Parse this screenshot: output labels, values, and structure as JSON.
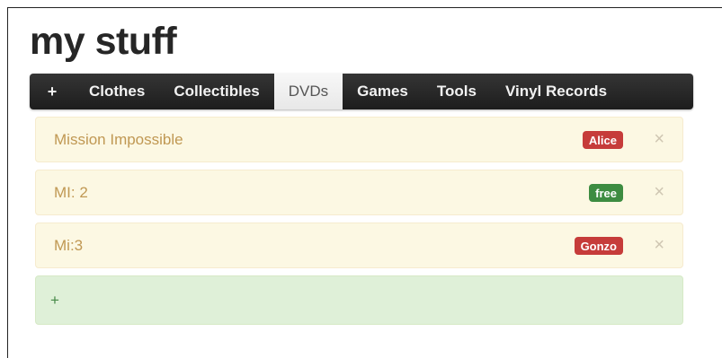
{
  "page": {
    "title": "my stuff"
  },
  "nav": {
    "add_label": "+",
    "tabs": [
      {
        "label": "Clothes",
        "active": false
      },
      {
        "label": "Collectibles",
        "active": false
      },
      {
        "label": "DVDs",
        "active": true
      },
      {
        "label": "Games",
        "active": false
      },
      {
        "label": "Tools",
        "active": false
      },
      {
        "label": "Vinyl Records",
        "active": false
      }
    ]
  },
  "items": [
    {
      "title": "Mission Impossible",
      "badge": "Alice",
      "badge_color": "#c63c3a",
      "remove_icon": "×"
    },
    {
      "title": "MI: 2",
      "badge": "free",
      "badge_color": "#3d8c41",
      "remove_icon": "×"
    },
    {
      "title": "Mi:3",
      "badge": "Gonzo",
      "badge_color": "#c63c3a",
      "remove_icon": "×"
    }
  ],
  "add_item": {
    "label": "+"
  }
}
